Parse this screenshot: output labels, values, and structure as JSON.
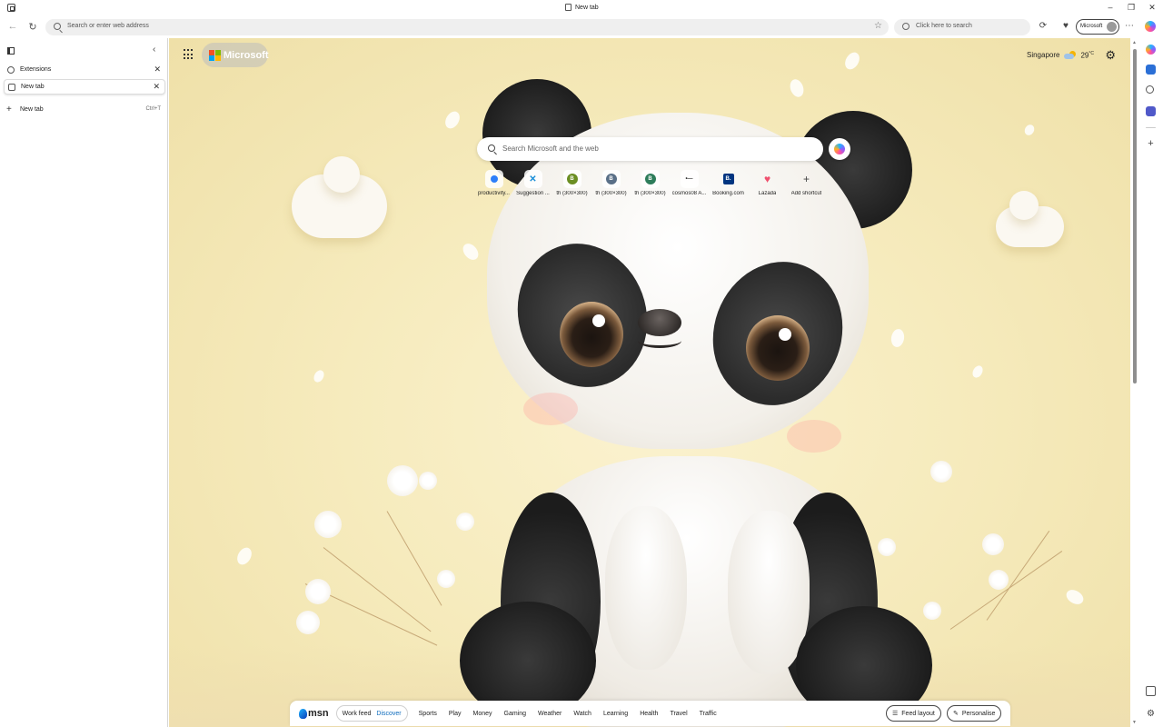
{
  "window": {
    "title": "New tab",
    "controls": [
      "minimize",
      "restore",
      "close"
    ]
  },
  "toolbar": {
    "address_placeholder": "Search or enter web address",
    "side_search_placeholder": "Click here to search",
    "profile_label": "Microsoft"
  },
  "vertical_tabs": {
    "tabs": [
      {
        "label": "Extensions",
        "active": false
      },
      {
        "label": "New tab",
        "active": true
      }
    ],
    "new_tab_label": "New tab",
    "new_tab_shortcut": "Ctrl+T"
  },
  "newtab": {
    "brand": "Microsoft",
    "weather": {
      "location": "Singapore",
      "temp": "29",
      "unit": "°C"
    },
    "search_placeholder": "Search Microsoft and the web",
    "shortcuts": [
      {
        "label": "productivity...",
        "icon": "blue-dot"
      },
      {
        "label": "Suggestion ...",
        "icon": "network-icon"
      },
      {
        "label": "th (300×300)",
        "icon": "B",
        "color": "#6b8e23"
      },
      {
        "label": "th (300×300)",
        "icon": "B",
        "color": "#5a7088"
      },
      {
        "label": "th (300×300)",
        "icon": "B",
        "color": "#2e7d5b"
      },
      {
        "label": "cosmos08 A...",
        "icon": "dots"
      },
      {
        "label": "Booking.com",
        "icon": "B.",
        "color": "#003580"
      },
      {
        "label": "Lazada",
        "icon": "heart",
        "color": "#f0506e"
      },
      {
        "label": "Add shortcut",
        "icon": "+"
      }
    ]
  },
  "msn": {
    "logo_text": "msn",
    "toggle": {
      "work": "Work feed",
      "discover": "Discover"
    },
    "categories": [
      "Sports",
      "Play",
      "Money",
      "Gaming",
      "Weather",
      "Watch",
      "Learning",
      "Health",
      "Travel",
      "Traffic"
    ],
    "feed_layout": "Feed layout",
    "personalise": "Personalise"
  }
}
